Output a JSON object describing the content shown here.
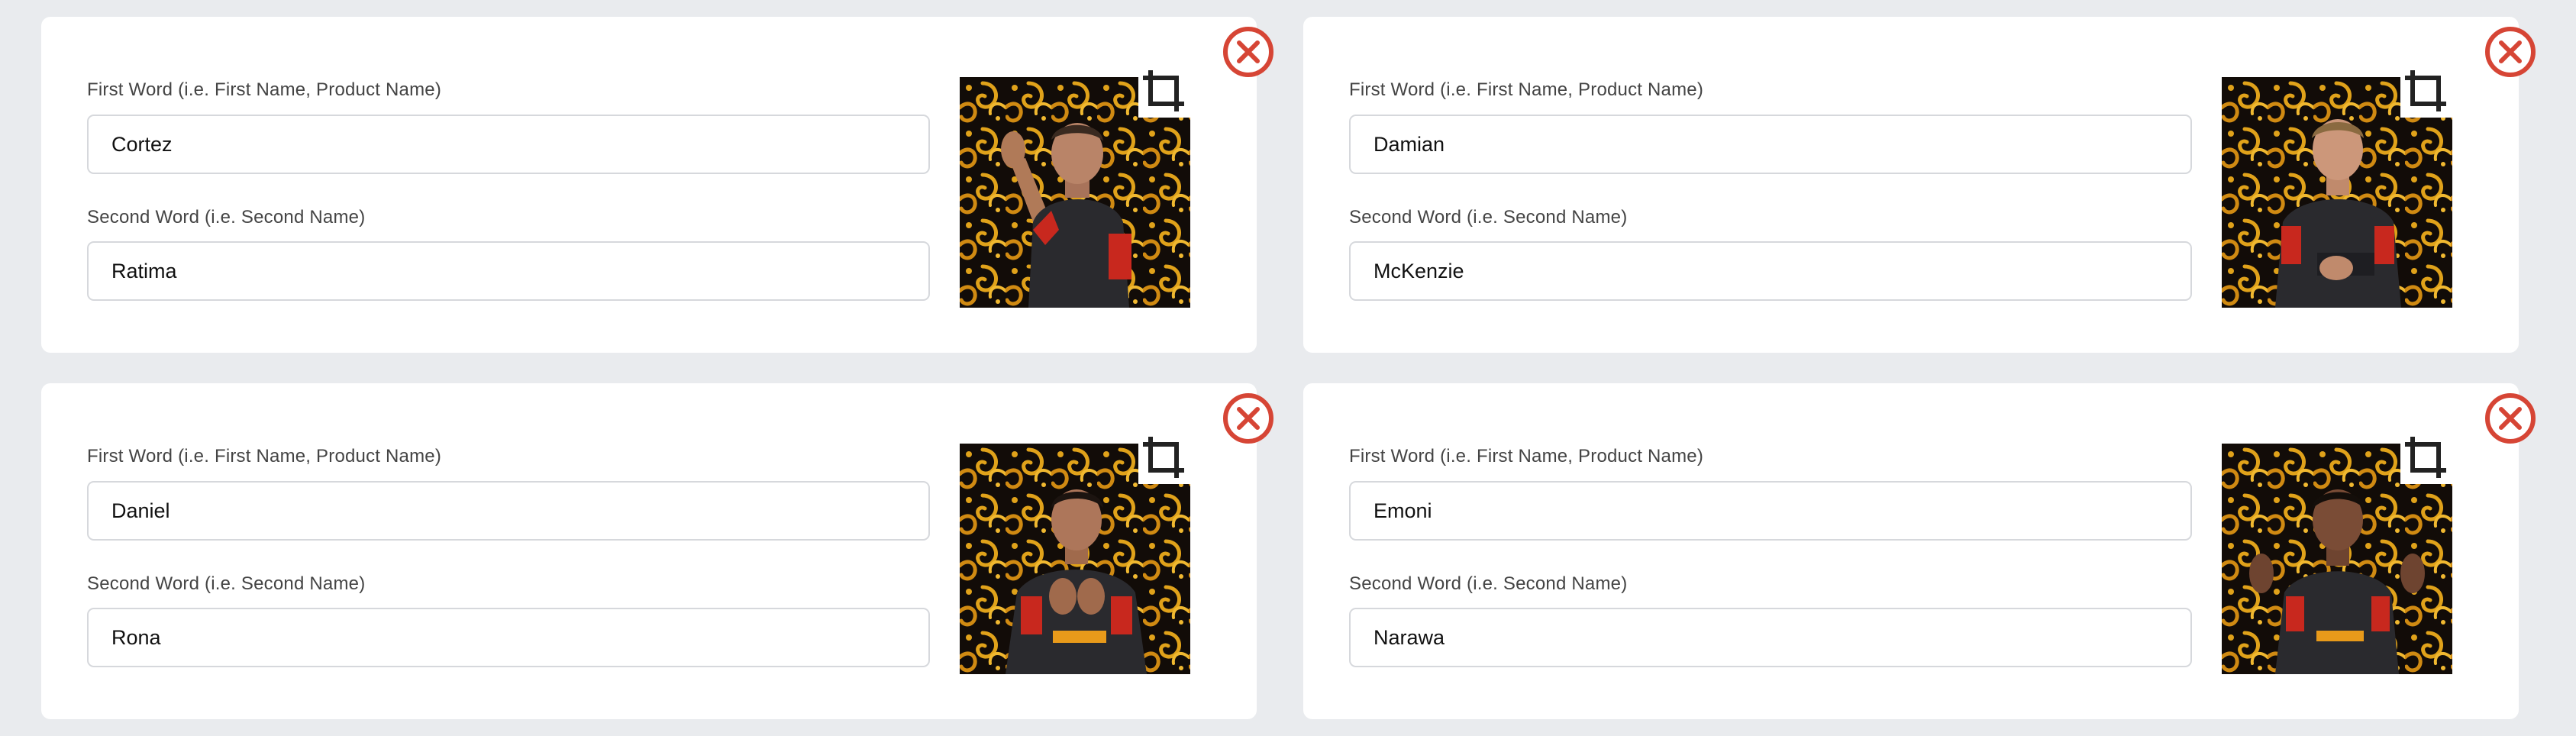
{
  "labels": {
    "first": "First Word (i.e. First Name, Product Name)",
    "second": "Second Word (i.e. Second Name)"
  },
  "colors": {
    "accent_close": "#d64535",
    "page_bg": "#e9ebee",
    "card_bg": "#ffffff",
    "pattern_gold": "#e0a21a",
    "pattern_dark": "#120c08",
    "jersey_dark": "#2a2a2e",
    "jersey_red": "#c8281e"
  },
  "icons": {
    "close": "close-circle-icon",
    "crop": "crop-icon"
  },
  "entries": [
    {
      "first_word": "Cortez",
      "second_word": "Ratima",
      "photo": "player-photo"
    },
    {
      "first_word": "Damian",
      "second_word": "McKenzie",
      "photo": "player-photo"
    },
    {
      "first_word": "Daniel",
      "second_word": "Rona",
      "photo": "player-photo"
    },
    {
      "first_word": "Emoni",
      "second_word": "Narawa",
      "photo": "player-photo"
    }
  ]
}
